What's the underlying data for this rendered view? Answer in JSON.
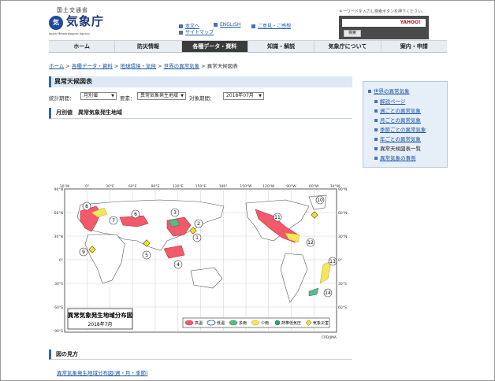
{
  "header": {
    "ministry": "国土交通省",
    "logo_title": "気象庁",
    "logo_sub": "Japan Meteorological Agency",
    "logo_mark": "気",
    "links": [
      "本文へ",
      "ENGLISH",
      "ご意見・ご感想",
      "サイトマップ"
    ]
  },
  "search": {
    "label": "キーワードを入力し検索ボタンを押下ください。",
    "placeholder": "",
    "powered": "YAHOO!",
    "button": "検索"
  },
  "nav": {
    "items": [
      "ホーム",
      "防災情報",
      "各種データ・資料",
      "知識・解説",
      "気象庁について",
      "案内・申請"
    ],
    "active_index": 2
  },
  "breadcrumb": {
    "items": [
      "ホーム",
      "各種データ・資料",
      "地球環境・気候",
      "世界の異常気象",
      "異常天候図表"
    ],
    "separator": " > "
  },
  "page": {
    "title": "異常天候図表",
    "stat_label": "統計期間：",
    "stat_value": "月別値",
    "element_label": "要素：",
    "element_value": "異常気象発生地域",
    "target_label": "対象期間：",
    "target_value": "2018年07月",
    "section_head": "月別値　異常気象発生地域"
  },
  "map": {
    "title": "異常気象発生地域分布図",
    "subtitle": "2018年7月",
    "credit": "CPD/JMA",
    "lon_labels_top": [
      "30°W",
      "0°",
      "30°E",
      "60°E",
      "90°E",
      "120°E",
      "150°E",
      "180°",
      "150°W",
      "120°W",
      "90°W",
      "60°W",
      "30°W"
    ],
    "lat_labels": [
      "90°N",
      "60°N",
      "30°N",
      "0°",
      "30°S",
      "60°S",
      "90°S"
    ],
    "legend": [
      "高温",
      "低温",
      "多雨",
      "少雨",
      "熱帯低気圧",
      "気象災害"
    ],
    "colors": {
      "heat": "#f05a6a",
      "cold": "#2457b5",
      "wet": "#5cb88a",
      "dry": "#f4e65c",
      "cyclone": "#2aa36b",
      "disaster": "#f3e21c"
    },
    "markers": [
      "1",
      "2",
      "3",
      "4",
      "5",
      "6",
      "7",
      "8",
      "9",
      "10",
      "11",
      "12",
      "13",
      "14"
    ]
  },
  "sidebar": {
    "top": "世界の異常気象",
    "items": [
      "解説ページ",
      "週ごとの異常気象",
      "月ごとの異常気象",
      "季節ごとの異常気象",
      "年ごとの異常気象",
      "異常天候図表一覧",
      "異常気象の事例"
    ],
    "current_index": 5
  },
  "bottom": {
    "howto": "図の見方",
    "sub": "異常気象発生地域分布図(週・月・季節)"
  }
}
